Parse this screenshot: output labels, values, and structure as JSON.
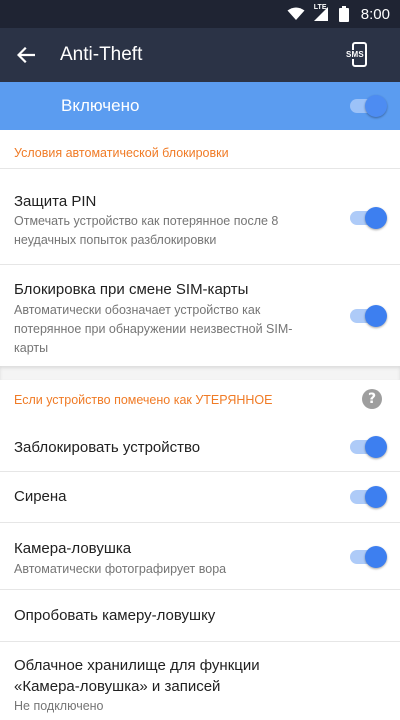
{
  "status_bar": {
    "time": "8:00",
    "network_label": "LTE",
    "icons": [
      "wifi-icon",
      "signal-icon",
      "battery-icon"
    ]
  },
  "app_bar": {
    "title": "Anti-Theft",
    "back_icon": "arrow-back-icon",
    "sms_label": "SMS"
  },
  "enabled": {
    "label": "Включено",
    "on": true
  },
  "section_auto_lock": {
    "header": "Условия автоматической блокировки",
    "items": [
      {
        "title": "Защита PIN",
        "subtitle": "Отмечать устройство как потерянное после 8 неудачных попыток разблокировки",
        "on": true
      },
      {
        "title": "Блокировка при смене SIM-карты",
        "subtitle": "Автоматически обозначает устройство как потерянное при обнаружении неизвестной SIM-карты",
        "on": true
      }
    ]
  },
  "section_lost": {
    "header": "Если устройство помечено как УТЕРЯННОЕ",
    "help_label": "?",
    "items": [
      {
        "title": "Заблокировать устройство",
        "on": true
      },
      {
        "title": "Сирена",
        "on": true
      },
      {
        "title": "Камера-ловушка",
        "subtitle": "Автоматически фотографирует вора",
        "on": true
      },
      {
        "title": "Опробовать камеру-ловушку"
      },
      {
        "title": "Облачное хранилище для функции «Камера-ловушка» и записей",
        "subtitle": "Не подключено"
      }
    ]
  },
  "colors": {
    "status_bar": "#1f2433",
    "app_bar": "#2b3346",
    "enabled_bar": "#5b9cf0",
    "accent": "#3d7ff0",
    "section_header": "#f07b26"
  }
}
